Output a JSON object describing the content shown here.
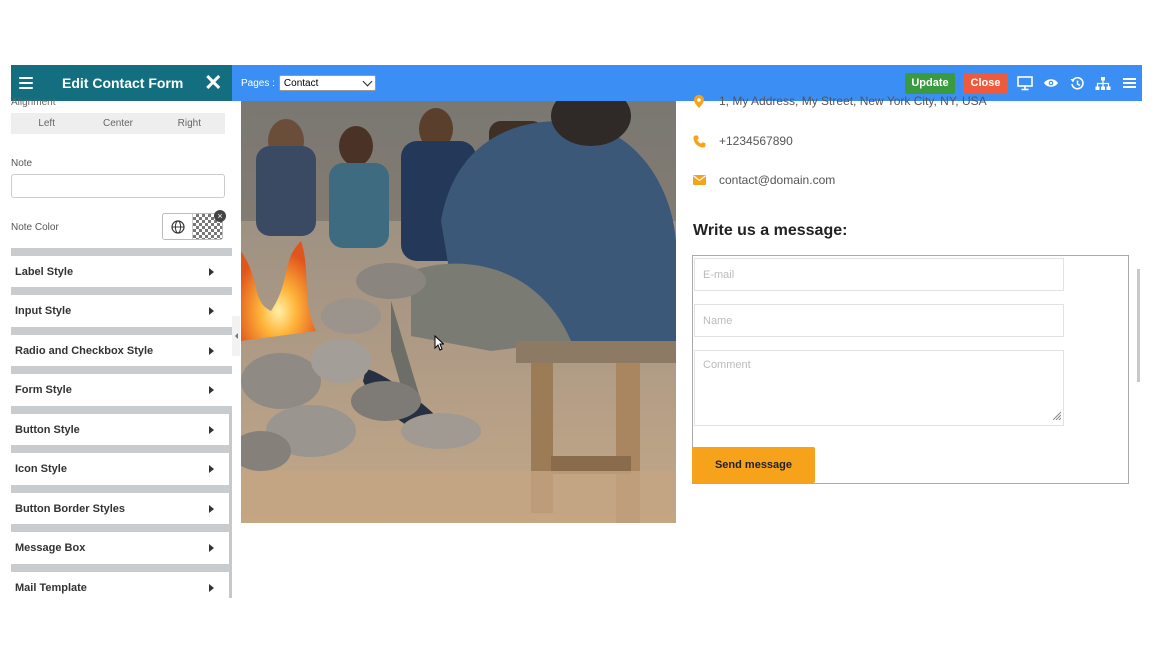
{
  "sidebar": {
    "title": "Edit Contact Form",
    "alignment_label": "Alignment",
    "alignment_options": [
      "Left",
      "Center",
      "Right"
    ],
    "note_label": "Note",
    "note_value": "",
    "note_color_label": "Note Color",
    "sections": [
      {
        "label": "Label Style"
      },
      {
        "label": "Input Style"
      },
      {
        "label": "Radio and Checkbox Style"
      },
      {
        "label": "Form Style"
      },
      {
        "label": "Button Style"
      },
      {
        "label": "Icon Style"
      },
      {
        "label": "Button Border Styles"
      },
      {
        "label": "Message Box"
      },
      {
        "label": "Mail Template"
      }
    ]
  },
  "topbar": {
    "pages_label": "Pages :",
    "pages_selected": "Contact",
    "update_label": "Update",
    "close_label": "Close",
    "icons": [
      "desktop-icon",
      "eye-icon",
      "history-icon",
      "sitemap-icon",
      "menu-icon"
    ]
  },
  "contact": {
    "address": "1, My Address, My Street, New York City, NY, USA",
    "phone": "+1234567890",
    "email": "contact@domain.com"
  },
  "form": {
    "heading": "Write us a message:",
    "email_placeholder": "E-mail",
    "name_placeholder": "Name",
    "comment_placeholder": "Comment",
    "send_label": "Send message"
  },
  "colors": {
    "sidebar_header": "#136f7f",
    "topbar": "#3b8ff4",
    "update": "#3a9a3f",
    "close": "#ef5a3c",
    "accent": "#f7a21b"
  }
}
